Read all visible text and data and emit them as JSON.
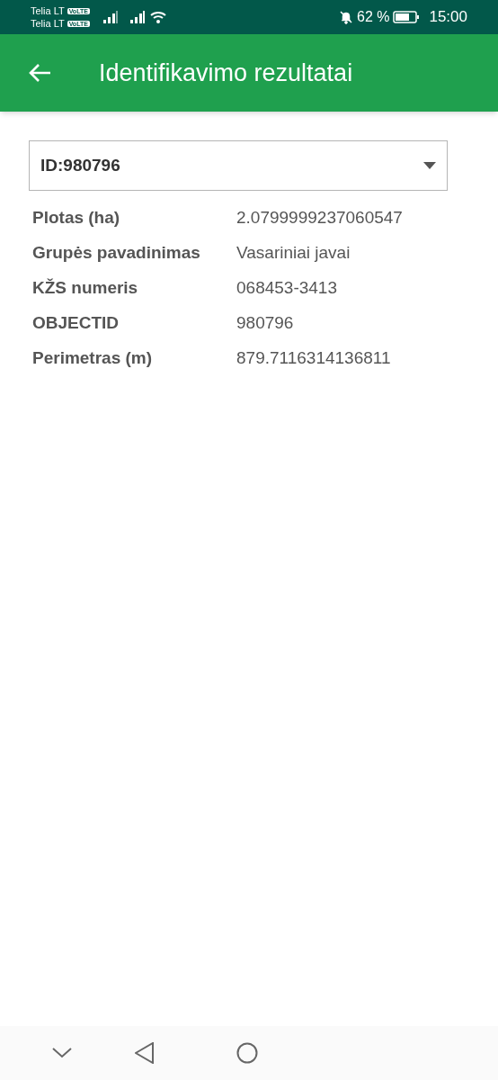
{
  "status_bar": {
    "carriers": [
      {
        "name": "Telia LT",
        "badge": "VoLTE"
      },
      {
        "name": "Telia LT",
        "badge": "VoLTE"
      }
    ],
    "battery": "62 %",
    "time": "15:00"
  },
  "app_bar": {
    "title": "Identifikavimo rezultatai"
  },
  "dropdown": {
    "value": "ID:980796"
  },
  "attributes": [
    {
      "label": "Plotas (ha)",
      "value": "2.0799999237060547"
    },
    {
      "label": "Grupės pavadinimas",
      "value": "Vasariniai javai"
    },
    {
      "label": "KŽS numeris",
      "value": "068453-3413"
    },
    {
      "label": "OBJECTID",
      "value": "980796"
    },
    {
      "label": "Perimetras (m)",
      "value": "879.7116314136811"
    }
  ]
}
